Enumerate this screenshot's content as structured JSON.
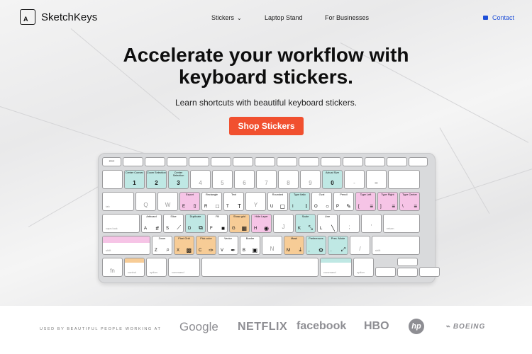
{
  "nav": {
    "brand": "SketchKeys",
    "logo_mark": "A",
    "items": [
      {
        "label": "Stickers",
        "has_dropdown": true
      },
      {
        "label": "Laptop Stand"
      },
      {
        "label": "For Businesses"
      }
    ],
    "contact": "Contact"
  },
  "hero": {
    "title_line1": "Accelerate your workflow with",
    "title_line2": "keyboard stickers.",
    "subtitle": "Learn shortcuts with beautiful keyboard stickers.",
    "cta": "Shop Stickers"
  },
  "keyboard": {
    "fn_row": [
      "esc",
      "",
      "",
      "",
      "",
      "",
      "",
      "",
      "",
      "",
      "",
      "",
      "",
      "",
      ""
    ],
    "num_row": [
      {
        "t": "",
        "c": "",
        "sub": "~"
      },
      {
        "t": "Center Convex",
        "c": "1",
        "color": "teal"
      },
      {
        "t": "Zoom Selection",
        "c": "2",
        "color": "teal"
      },
      {
        "t": "Center Selection",
        "c": "3",
        "color": "teal"
      },
      {
        "t": "",
        "c": "4"
      },
      {
        "t": "",
        "c": "5"
      },
      {
        "t": "",
        "c": "6"
      },
      {
        "t": "",
        "c": "7"
      },
      {
        "t": "",
        "c": "8"
      },
      {
        "t": "",
        "c": "9"
      },
      {
        "t": "Actual Size",
        "c": "0",
        "color": "teal"
      },
      {
        "t": "",
        "c": "-"
      },
      {
        "t": "",
        "c": "="
      },
      {
        "t": "",
        "c": ""
      }
    ],
    "q_row": [
      {
        "t": "",
        "c": "tab"
      },
      {
        "t": "",
        "c": "Q"
      },
      {
        "t": "",
        "c": "W"
      },
      {
        "t": "Export",
        "c": "E",
        "icon": "⇧",
        "color": "pink"
      },
      {
        "t": "Rectangle",
        "c": "R",
        "icon": "□"
      },
      {
        "t": "Text",
        "c": "T",
        "icon": "T"
      },
      {
        "t": "",
        "c": "Y"
      },
      {
        "t": "Rounded",
        "c": "U",
        "icon": "▢"
      },
      {
        "t": "Type Italic",
        "c": "I",
        "icon": "I",
        "color": "teal"
      },
      {
        "t": "Oval",
        "c": "O",
        "icon": "○"
      },
      {
        "t": "Pencil",
        "c": "P",
        "icon": "✎"
      },
      {
        "t": "Type Left",
        "c": "[",
        "icon": "≡",
        "color": "pink"
      },
      {
        "t": "Type Right",
        "c": "]",
        "icon": "≡",
        "color": "pink"
      },
      {
        "t": "Type Center",
        "c": "\\",
        "icon": "≡",
        "color": "pink"
      }
    ],
    "a_row": [
      {
        "t": "",
        "c": "caps lock"
      },
      {
        "t": "Artboard",
        "c": "A",
        "icon": "#"
      },
      {
        "t": "Slice",
        "c": "S",
        "icon": "⟋"
      },
      {
        "t": "Duplicate",
        "c": "D",
        "icon": "⧉",
        "color": "teal"
      },
      {
        "t": "Fill",
        "c": "F",
        "icon": "■"
      },
      {
        "t": "Show grid",
        "c": "G",
        "icon": "▦",
        "color": "orange"
      },
      {
        "t": "Hide Layer",
        "c": "H",
        "icon": "◉",
        "color": "pink"
      },
      {
        "t": "",
        "c": "J"
      },
      {
        "t": "Scale",
        "c": "K",
        "icon": "⤡",
        "color": "teal"
      },
      {
        "t": "Line",
        "c": "L",
        "icon": "╲"
      },
      {
        "t": "",
        "c": ";"
      },
      {
        "t": "",
        "c": "'"
      },
      {
        "t": "",
        "c": "return"
      }
    ],
    "z_row": [
      {
        "t": "",
        "c": "shift",
        "color": "pink"
      },
      {
        "t": "Zoom",
        "c": "Z",
        "icon": "⌕"
      },
      {
        "t": "Pixel Grid",
        "c": "X",
        "icon": "▩",
        "color": "orange"
      },
      {
        "t": "Pick color",
        "c": "C",
        "icon": "✑",
        "color": "orange"
      },
      {
        "t": "Vector",
        "c": "V",
        "icon": "✒"
      },
      {
        "t": "Border",
        "c": "B",
        "icon": "▣"
      },
      {
        "t": "",
        "c": "N"
      },
      {
        "t": "Mask",
        "c": "M",
        "icon": "⤓",
        "color": "orange"
      },
      {
        "t": "Preferences",
        "c": ",",
        "icon": "⚙",
        "color": "teal"
      },
      {
        "t": "Pres. Mode",
        "c": ".",
        "icon": "⤢",
        "color": "teal"
      },
      {
        "t": "",
        "c": "/"
      },
      {
        "t": "",
        "c": "shift"
      }
    ],
    "bottom_row": [
      {
        "c": "fn"
      },
      {
        "c": "control",
        "color": "orange"
      },
      {
        "c": "option"
      },
      {
        "c": "command"
      },
      {
        "c": ""
      },
      {
        "c": "command",
        "color": "teal"
      },
      {
        "c": "option"
      },
      {
        "c": ""
      },
      {
        "c": ""
      },
      {
        "c": ""
      }
    ]
  },
  "brands": {
    "used_by": "USED BY BEAUTIFUL PEOPLE WORKING AT",
    "items": [
      "Google",
      "NETFLIX",
      "facebook",
      "HBO",
      "hp",
      "BOEING"
    ]
  }
}
